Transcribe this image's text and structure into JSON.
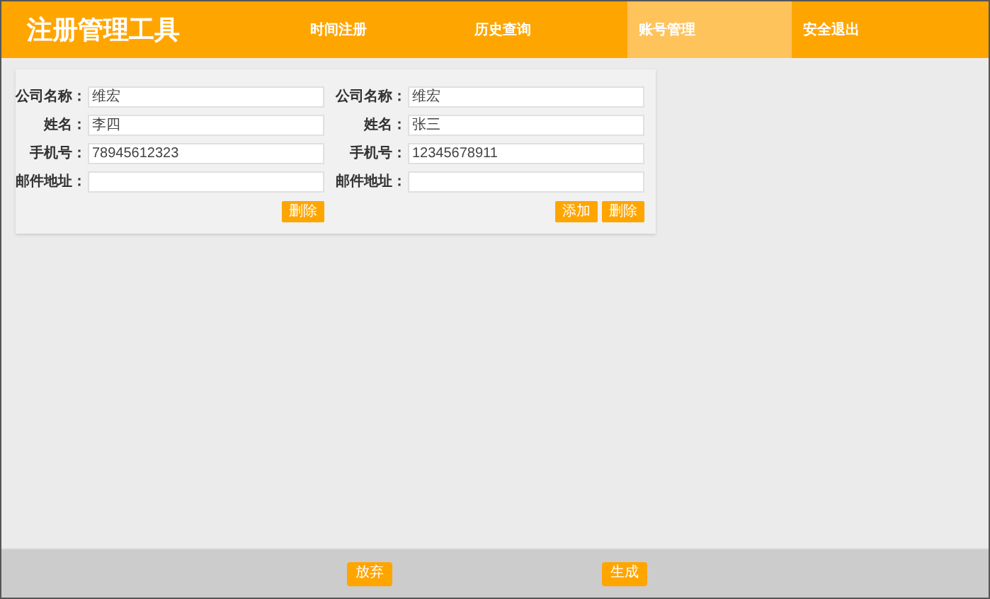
{
  "app_title": "注册管理工具",
  "nav": [
    {
      "label": "时间注册",
      "selected": false
    },
    {
      "label": "历史查询",
      "selected": false
    },
    {
      "label": "账号管理",
      "selected": true
    },
    {
      "label": "安全退出",
      "selected": false
    }
  ],
  "accounts": [
    {
      "fields": [
        {
          "label": "公司名称：",
          "value": "维宏"
        },
        {
          "label": "姓名：",
          "value": "李四"
        },
        {
          "label": "手机号：",
          "value": "78945612323"
        },
        {
          "label": "邮件地址："
        }
      ],
      "buttons": [
        "删除"
      ]
    },
    {
      "fields": [
        {
          "label": "公司名称：",
          "value": "维宏"
        },
        {
          "label": "姓名：",
          "value": "张三"
        },
        {
          "label": "手机号：",
          "value": "12345678911"
        },
        {
          "label": "邮件地址："
        }
      ],
      "buttons": [
        "添加",
        "删除"
      ]
    }
  ],
  "footer_buttons": [
    "放弃",
    "生成"
  ]
}
